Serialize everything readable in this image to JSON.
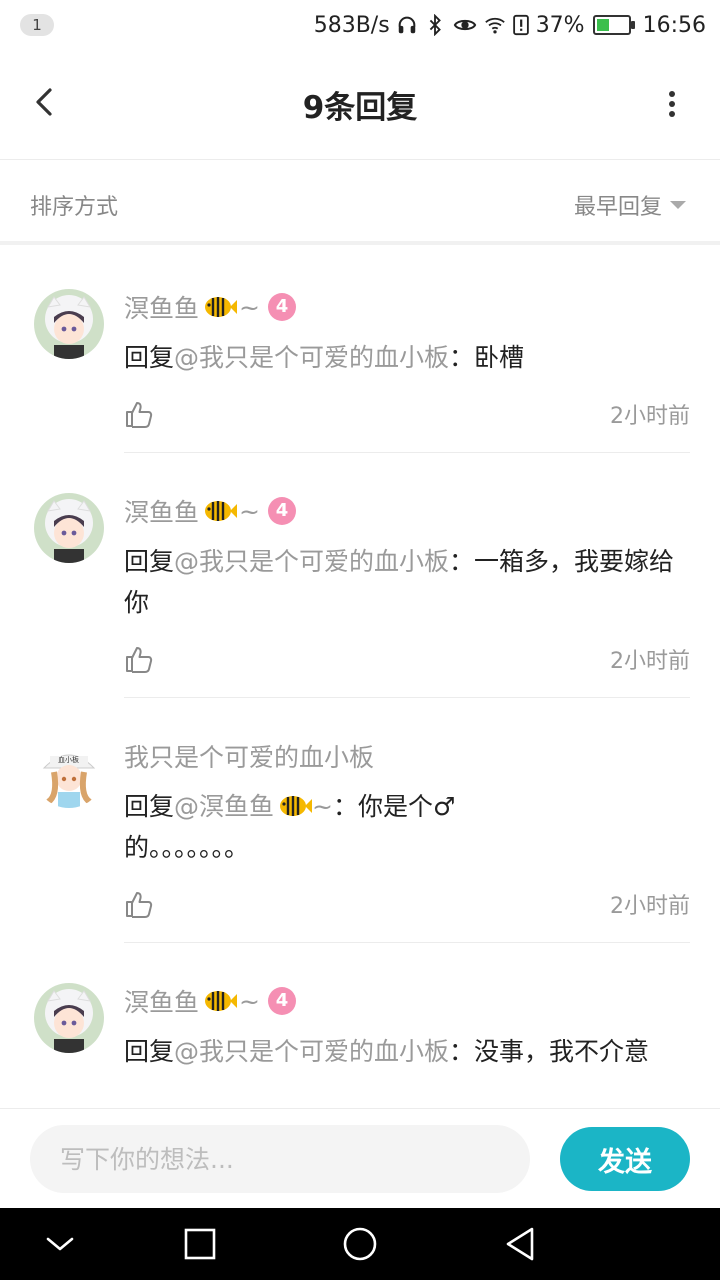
{
  "status_bar": {
    "notification_count": "1",
    "net_speed": "583B/s",
    "battery_percent": "37%",
    "battery_level": 0.37,
    "time": "16:56",
    "icons": [
      "headphones-icon",
      "bluetooth-icon",
      "eye-icon",
      "wifi-icon",
      "alert-icon",
      "battery-icon"
    ]
  },
  "header": {
    "title": "9条回复",
    "back_icon": "chevron-left-icon",
    "more_icon": "more-vertical-icon"
  },
  "sort": {
    "label": "排序方式",
    "value": "最早回复"
  },
  "replies": [
    {
      "user": "溟鱼鱼",
      "emoji": "fish-emoji",
      "suffix": "~",
      "level": "4",
      "reply_prefix": "回复",
      "mention": "@我只是个可爱的血小板",
      "colon": "：",
      "text": "卧槽",
      "time": "2小时前"
    },
    {
      "user": "溟鱼鱼",
      "emoji": "fish-emoji",
      "suffix": "~",
      "level": "4",
      "reply_prefix": "回复",
      "mention": "@我只是个可爱的血小板",
      "colon": "：",
      "text": "一箱多，我要嫁给你",
      "time": "2小时前"
    },
    {
      "user": "我只是个可爱的血小板",
      "reply_prefix": "回复",
      "mention": "@溟鱼鱼",
      "mention_suffix": "~",
      "colon": "：",
      "text_line1": "你是个♂",
      "text_line2": "的。。。。。。。",
      "time": "2小时前"
    },
    {
      "user": "溟鱼鱼",
      "emoji": "fish-emoji",
      "suffix": "~",
      "level": "4",
      "reply_prefix": "回复",
      "mention": "@我只是个可爱的血小板",
      "colon": "：",
      "text": "没事，我不介意"
    }
  ],
  "input": {
    "placeholder": "写下你的想法...",
    "send_label": "发送"
  },
  "colors": {
    "accent": "#1bb5c6",
    "level_badge": "#f58fb3",
    "muted_text": "#9a9a9a"
  }
}
